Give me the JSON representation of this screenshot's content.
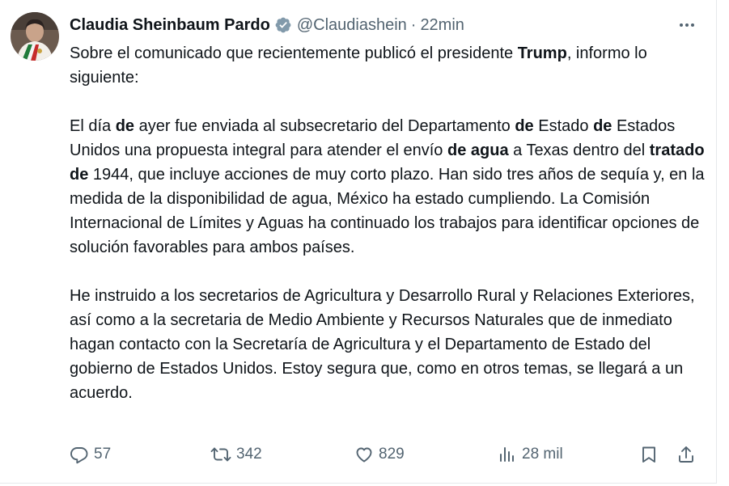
{
  "author": {
    "display_name": "Claudia Sheinbaum Pardo",
    "handle": "@Claudiashein",
    "separator": "·",
    "timestamp": "22min",
    "verified": true,
    "verified_color": "#829aab"
  },
  "more_icon": "more-horizontal-icon",
  "body": {
    "p1": {
      "s1": "Sobre el comunicado que recientemente publicó el presidente ",
      "b1": "Trump",
      "s2": ", informo lo siguiente:"
    },
    "p2": {
      "s1": "El día ",
      "b1": "de",
      "s2": " ayer fue enviada al subsecretario del Departamento ",
      "b2": "de",
      "s3": " Estado ",
      "b3": "de",
      "s4": " Estados Unidos una propuesta integral para atender el envío ",
      "b4": "de agua",
      "s5": " a Texas dentro del ",
      "b5": "tratado de",
      "s6": " 1944, que incluye acciones de muy corto plazo. Han sido tres años de sequía y, en la medida de la disponibilidad de agua, México ha estado cumpliendo. La Comisión Internacional de Límites y Aguas ha continuado los trabajos para identificar opciones de solución favorables para ambos países."
    },
    "p3": "He instruido a los secretarios de Agricultura y Desarrollo Rural y Relaciones Exteriores, así como a la secretaria de Medio Ambiente y Recursos Naturales que de inmediato hagan contacto con la Secretaría de Agricultura y el Departamento de Estado del gobierno de Estados Unidos. Estoy segura que, como en otros temas, se llegará a un acuerdo."
  },
  "actions": {
    "replies": {
      "icon": "reply-icon",
      "count": "57"
    },
    "reposts": {
      "icon": "repost-icon",
      "count": "342"
    },
    "likes": {
      "icon": "heart-icon",
      "count": "829"
    },
    "views": {
      "icon": "views-icon",
      "count": "28 mil"
    },
    "bookmark": {
      "icon": "bookmark-icon"
    },
    "share": {
      "icon": "share-icon"
    }
  },
  "colors": {
    "text": "#0f1419",
    "secondary": "#536471"
  }
}
